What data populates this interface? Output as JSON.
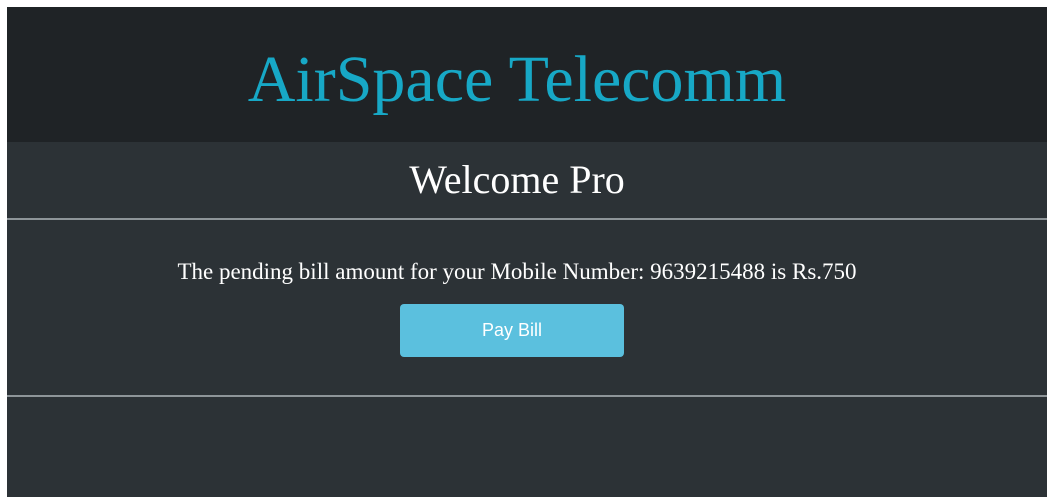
{
  "header": {
    "brand": "AirSpace Telecomm"
  },
  "main": {
    "welcome": "Welcome Pro",
    "bill_message": "The pending bill amount for your Mobile Number: 9639215488 is Rs.750",
    "pay_button_label": "Pay Bill"
  },
  "colors": {
    "brand": "#17a8c6",
    "header_bg": "#1f2326",
    "page_bg": "#2c3236",
    "button_bg": "#5bc0de",
    "divider": "#8e9599"
  }
}
